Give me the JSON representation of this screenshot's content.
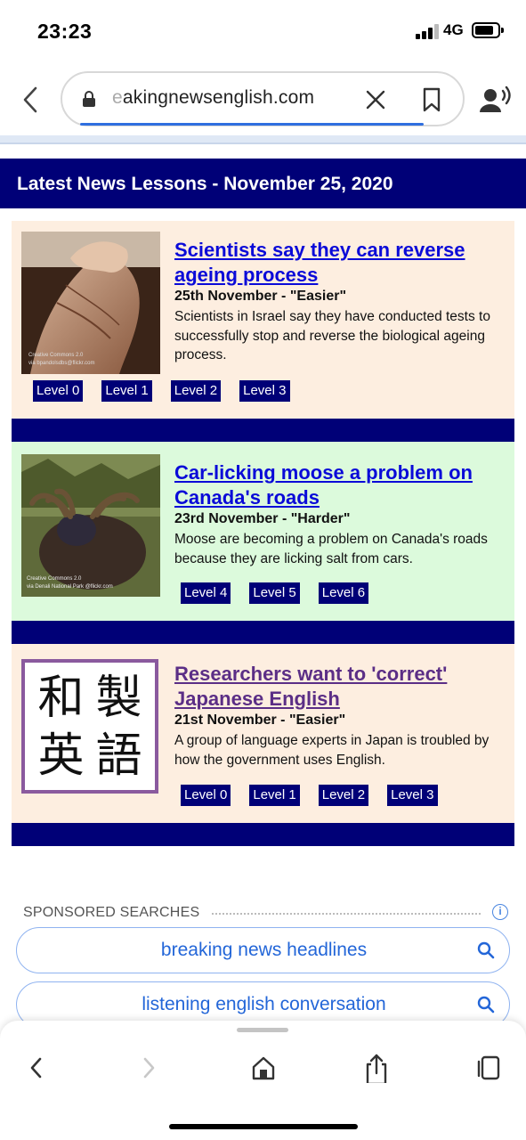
{
  "status_bar": {
    "time": "23:23",
    "network": "4G"
  },
  "browser": {
    "url_faded": "e",
    "url": "akingnewsenglish.com",
    "icons": [
      "back-chevron-icon",
      "lock-icon",
      "clear-icon",
      "bookmark-icon",
      "voice-icon"
    ]
  },
  "page": {
    "header": "Latest News Lessons  -  November 25, 2020",
    "stories": [
      {
        "title": "Scientists say they can reverse ageing process",
        "date": "25th November - \"Easier\"",
        "description": "Scientists in Israel say they have conducted tests to successfully stop and reverse the biological ageing process.",
        "levels": [
          "Level 0",
          "Level 1",
          "Level 2",
          "Level 3"
        ],
        "background": "#fdeee0",
        "title_color": "#0a0ad8"
      },
      {
        "title": "Car-licking moose a problem on Canada's roads",
        "date": "23rd November - \"Harder\"",
        "description": "Moose are becoming a problem on Canada's roads because they are licking salt from cars.",
        "levels": [
          "Level 4",
          "Level 5",
          "Level 6"
        ],
        "background": "#dcfadc",
        "title_color": "#0a0ad8"
      },
      {
        "title": "Researchers want to 'correct' Japanese English",
        "date": "21st November - \"Easier\"",
        "description": "A group of language experts in Japan is troubled by how the government uses English.",
        "levels": [
          "Level 0",
          "Level 1",
          "Level 2",
          "Level 3"
        ],
        "background": "#fdeee0",
        "title_color": "#5b2e86",
        "thumb_text": [
          "和",
          "製",
          "英",
          "語"
        ]
      }
    ]
  },
  "sponsored": {
    "label": "SPONSORED SEARCHES",
    "searches": [
      "breaking news headlines",
      "listening english conversation"
    ]
  },
  "toolbar": {
    "icons": [
      "back-icon",
      "forward-icon",
      "home-icon",
      "share-icon",
      "tabs-icon"
    ]
  }
}
